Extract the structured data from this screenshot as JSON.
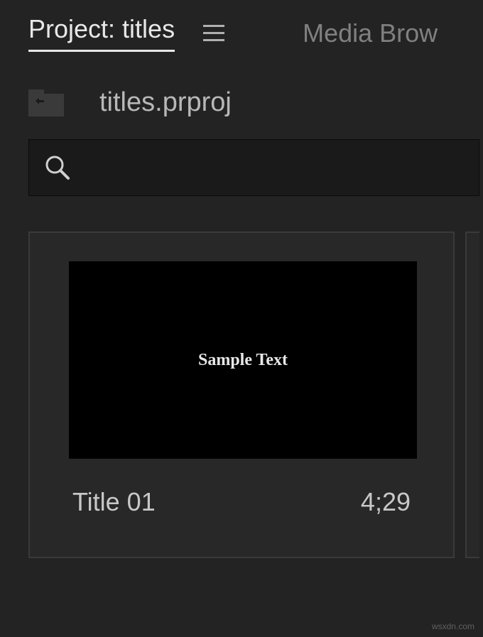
{
  "tabs": {
    "active": "Project: titles",
    "inactive": "Media Brow"
  },
  "project": {
    "filename": "titles.prproj"
  },
  "search": {
    "placeholder": ""
  },
  "bin": {
    "items": [
      {
        "name": "Title 01",
        "duration": "4;29",
        "thumbnail_text": "Sample Text"
      }
    ]
  },
  "watermark": "wsxdn.com"
}
